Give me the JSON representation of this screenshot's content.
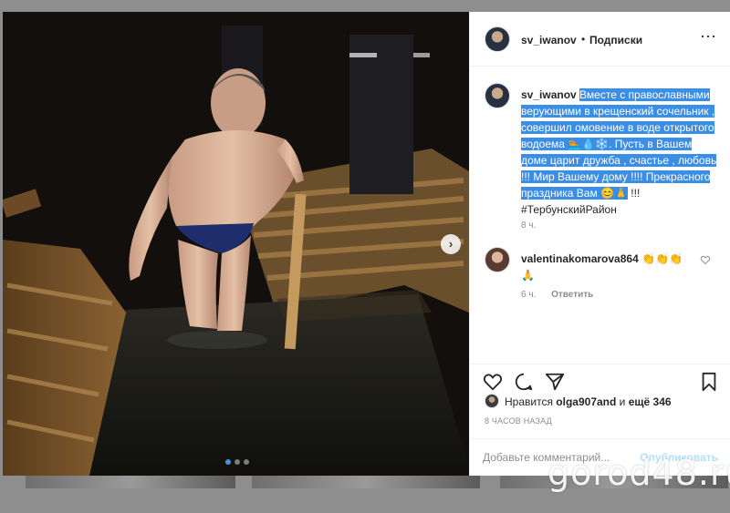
{
  "header": {
    "username": "sv_iwanov",
    "separator": "•",
    "follow_label": "Подписки",
    "more_icon": "more-horizontal-icon"
  },
  "caption": {
    "username": "sv_iwanov",
    "text": "Вместе с православными верующими в крещенский сочельник , совершил омовение в воде открытого водоема 🏊💧❄️. Пусть в Вашем доме царит дружба , счастье , любовь !!! Мир Вашему дому !!!! Прекрасного праздника Вам 😊🙏",
    "tail": "!!! #ТербунскийРайон",
    "time": "8 ч."
  },
  "comments": [
    {
      "username": "valentinakomarova864",
      "text": "👏👏👏 🙏",
      "time": "6 ч.",
      "reply_label": "Ответить"
    }
  ],
  "likes": {
    "prefix": "Нравится",
    "user": "olga907and",
    "middle": "и",
    "others": "ещё 346"
  },
  "post_date": "8 ЧАСОВ НАЗАД",
  "add_comment": {
    "placeholder": "Добавьте комментарий...",
    "publish_label": "Опубликовать"
  },
  "carousel": {
    "slides": 3,
    "active": 1
  },
  "watermark": "gorod48.ru",
  "colors": {
    "selection": "#3a8ee6",
    "carousel_active": "#4a90e2",
    "publish_disabled": "#b2dffc",
    "meta_gray": "#8e8e8e"
  }
}
